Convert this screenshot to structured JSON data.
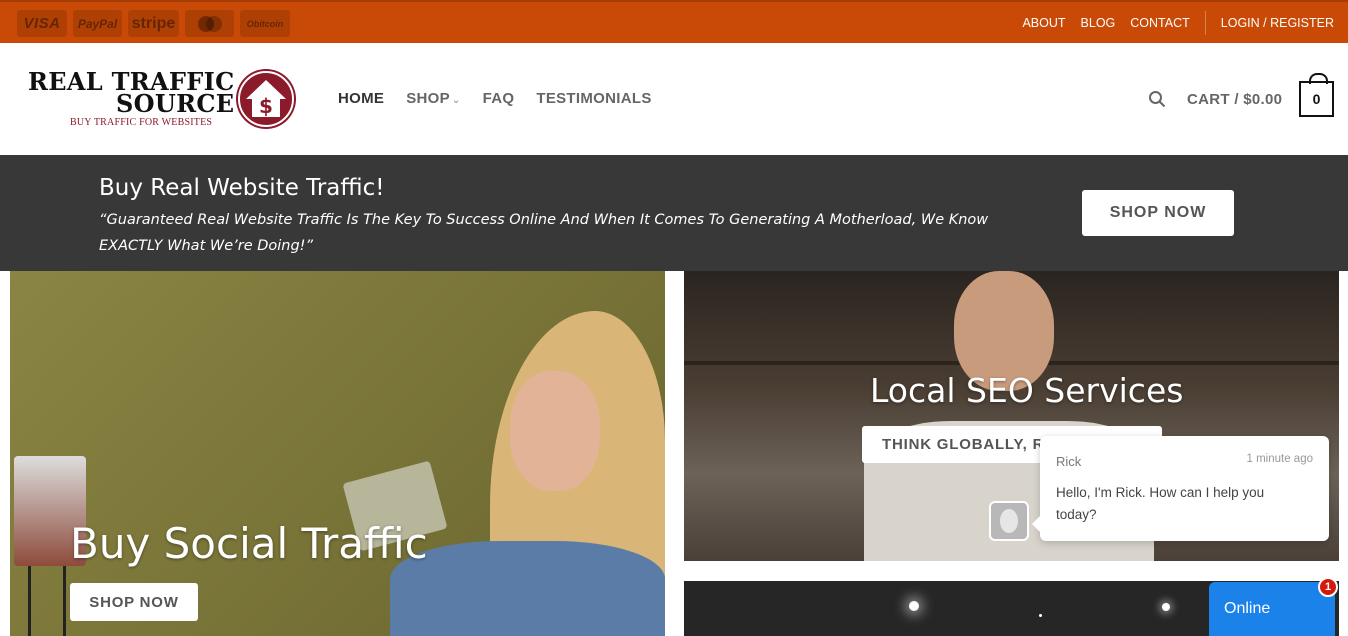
{
  "payment_badges": [
    {
      "name": "visa-badge",
      "label": "VISA"
    },
    {
      "name": "paypal-badge",
      "label": "PayPal"
    },
    {
      "name": "stripe-badge",
      "label": "stripe"
    },
    {
      "name": "mastercard-badge",
      "label": ""
    },
    {
      "name": "bitcoin-badge",
      "label": "Obitcoin"
    }
  ],
  "topnav": {
    "about": "ABOUT",
    "blog": "BLOG",
    "contact": "CONTACT",
    "login": "LOGIN / REGISTER"
  },
  "logo": {
    "line1": "REAL TRAFFIC",
    "line2": "SOURCE",
    "tagline": "BUY TRAFFIC FOR WEBSITES",
    "badge_symbol": "$"
  },
  "mainnav": {
    "home": "HOME",
    "shop": "SHOP",
    "faq": "FAQ",
    "testimonials": "TESTIMONIALS"
  },
  "cart": {
    "label": "CART / $0.00",
    "count": "0"
  },
  "banner": {
    "title": "Buy Real Website Traffic!",
    "quote": "“Guaranteed Real Website Traffic Is The Key To Success Online And When It Comes To Generating A Motherload, We Know EXACTLY What We’re Doing!”",
    "button": "SHOP NOW"
  },
  "tiles": {
    "social": {
      "title": "Buy Social Traffic",
      "button": "SHOP NOW"
    },
    "seo": {
      "title": "Local SEO Services",
      "button": "THINK GLOBALLY, RA"
    }
  },
  "chat": {
    "agent_name": "Rick",
    "time": "1 minute ago",
    "message": "Hello, I'm Rick. How can I help you today?",
    "status_button": "Online",
    "unread_count": "1"
  },
  "colors": {
    "topbar": "#c94a06",
    "banner": "#383838",
    "brand_maroon": "#8b1a2b",
    "chat_blue": "#1a82e8",
    "badge_red": "#d4190b"
  }
}
